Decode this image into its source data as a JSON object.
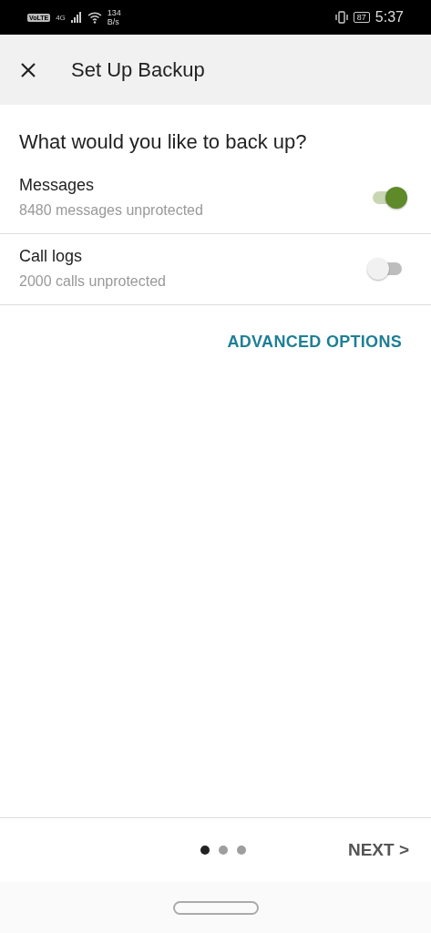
{
  "status_bar": {
    "volte": "VoLTE",
    "network": "4G",
    "speed": "134",
    "speed_unit": "B/s",
    "battery": "87",
    "time": "5:37"
  },
  "app_bar": {
    "title": "Set Up Backup"
  },
  "heading": "What would you like to back up?",
  "options": [
    {
      "title": "Messages",
      "subtitle": "8480 messages unprotected",
      "on": true
    },
    {
      "title": "Call logs",
      "subtitle": "2000 calls unprotected",
      "on": false
    }
  ],
  "advanced_link": "ADVANCED OPTIONS",
  "pager": [
    {
      "selected": true
    },
    {
      "selected": false
    },
    {
      "selected": false
    }
  ],
  "next_button": "NEXT >"
}
